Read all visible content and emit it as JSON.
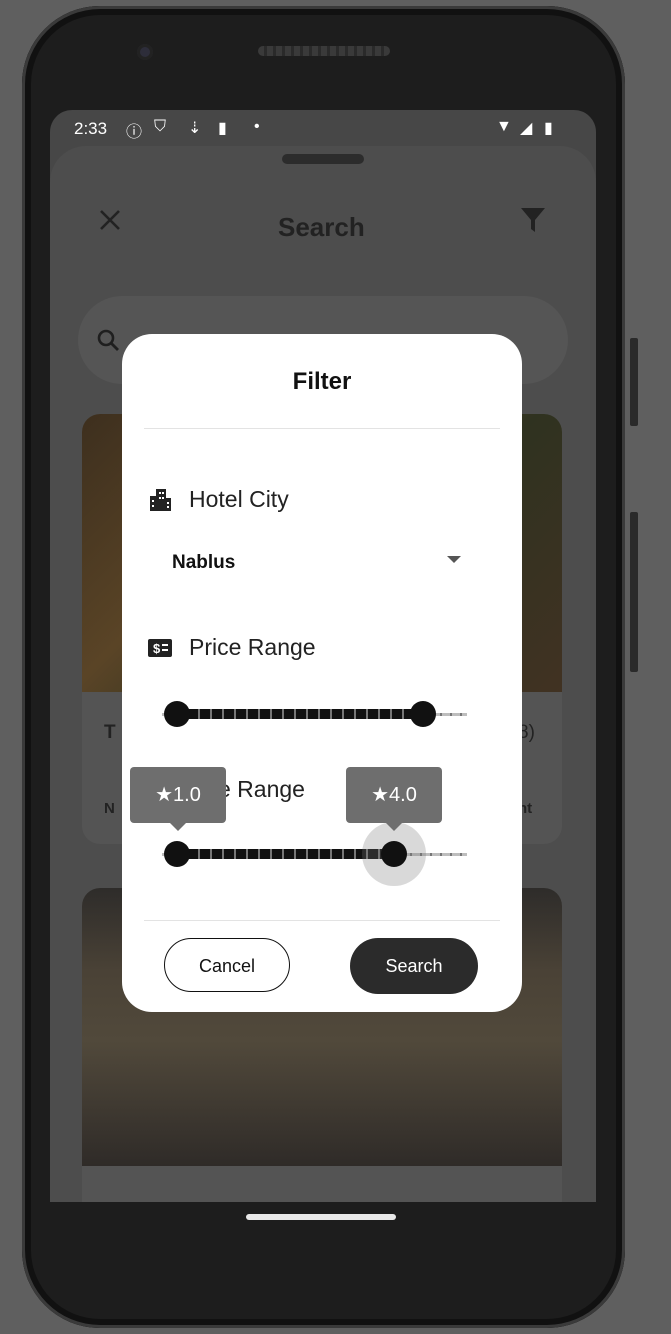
{
  "status_bar": {
    "time": "2:33",
    "left_icons": [
      "info-icon",
      "shield-icon",
      "download-icon",
      "sd-card-icon",
      "dot-icon"
    ],
    "right_icons": [
      "wifi-icon",
      "signal-icon",
      "battery-icon"
    ]
  },
  "header": {
    "title": "Search",
    "close_icon": "close-icon",
    "filter_icon": "filter-icon"
  },
  "search": {
    "icon": "search-icon"
  },
  "background_cards": [
    {
      "title_fragment": "T",
      "rating_fragment": "8)",
      "line_fragment": "N",
      "price_fragment": "ht"
    }
  ],
  "dialog": {
    "title": "Filter",
    "hotel_city": {
      "label": "Hotel City",
      "icon": "building-icon",
      "selected": "Nablus"
    },
    "price_range": {
      "label": "Price Range",
      "icon": "money-icon",
      "low": 0.0,
      "high": 0.85
    },
    "star_range": {
      "label_visible": "e Range",
      "low": 1.0,
      "high": 4.0,
      "low_tooltip": "★1.0",
      "high_tooltip": "★4.0",
      "min": 1,
      "max": 5
    },
    "cancel_label": "Cancel",
    "search_label": "Search"
  }
}
